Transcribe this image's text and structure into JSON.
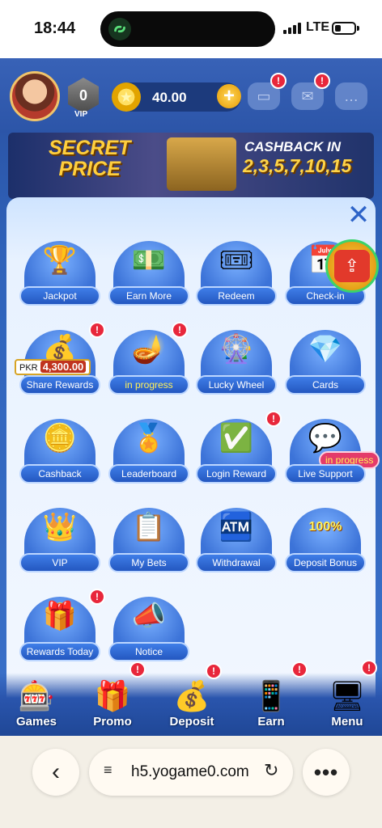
{
  "status": {
    "time": "18:44",
    "network": "LTE"
  },
  "topbar": {
    "vip_level": "0",
    "vip_label": "VIP",
    "balance": "40.00",
    "add_symbol": "+"
  },
  "banner": {
    "headline_1": "SECRET",
    "headline_2": "PRICE",
    "cashback_title": "CASHBACK IN",
    "cashback_days": "2,3,5,7,10,15"
  },
  "panel": {
    "close_symbol": "✕",
    "tiles": [
      {
        "label": "Jackpot",
        "icon": "trophy-icon"
      },
      {
        "label": "Earn More",
        "icon": "earn-more-icon"
      },
      {
        "label": "Redeem",
        "icon": "code-icon"
      },
      {
        "label": "Check-in",
        "icon": "check-in-icon"
      },
      {
        "label": "Share Rewards",
        "icon": "treasure-chest-icon",
        "prefix": "PKR",
        "amount": "4,300.00",
        "badge": "!"
      },
      {
        "label": "in progress",
        "icon": "magic-lamp-icon",
        "badge": "!"
      },
      {
        "label": "Lucky Wheel",
        "icon": "wheel-icon"
      },
      {
        "label": "Cards",
        "icon": "cards-icon"
      },
      {
        "label": "Cashback",
        "icon": "cashback-icon"
      },
      {
        "label": "Leaderboard",
        "icon": "leaderboard-icon"
      },
      {
        "label": "Login Reward",
        "icon": "login-reward-icon",
        "badge": "!"
      },
      {
        "label": "Live Support",
        "icon": "support-icon",
        "tag": "in progress"
      },
      {
        "label": "VIP",
        "icon": "crown-icon"
      },
      {
        "label": "My Bets",
        "icon": "bets-icon"
      },
      {
        "label": "Withdrawal",
        "icon": "atm-icon"
      },
      {
        "label": "Deposit Bonus",
        "icon": "deposit-bonus-icon",
        "art_text": "100%"
      },
      {
        "label": "Rewards Today",
        "icon": "gift-box-icon",
        "badge": "!"
      },
      {
        "label": "Notice",
        "icon": "megaphone-icon"
      }
    ]
  },
  "bottom_nav": [
    {
      "label": "Games",
      "icon": "games-icon"
    },
    {
      "label": "Promo",
      "icon": "promo-icon",
      "badge": "!"
    },
    {
      "label": "Deposit",
      "icon": "deposit-icon",
      "badge": "!"
    },
    {
      "label": "Earn",
      "icon": "earn-icon",
      "badge": "!"
    },
    {
      "label": "Menu",
      "icon": "menu-icon",
      "badge": "!"
    }
  ],
  "browser": {
    "url": "h5.yogame0.com"
  }
}
